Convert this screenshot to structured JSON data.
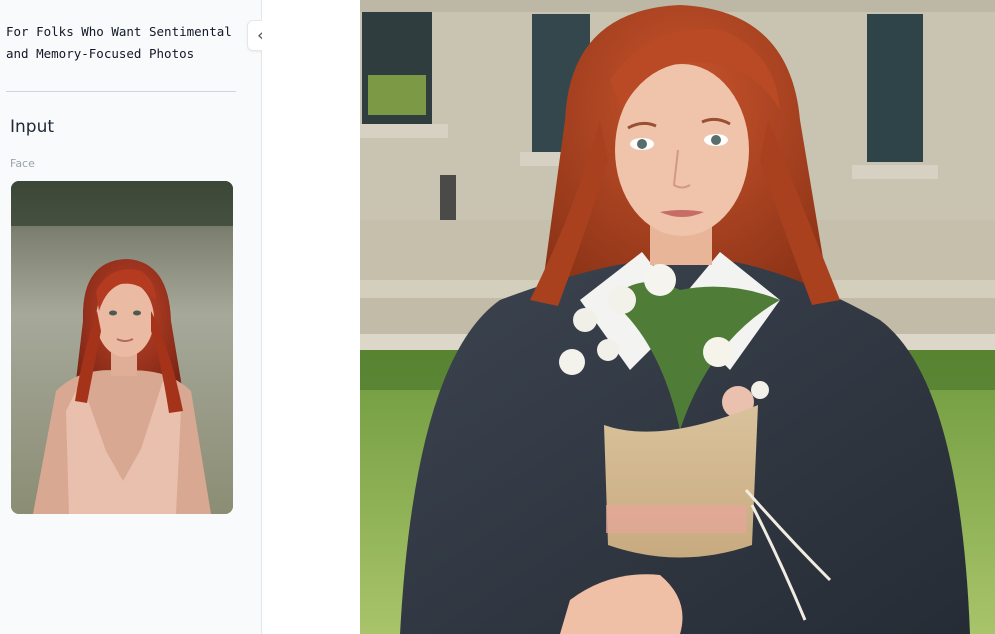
{
  "sidebar": {
    "tagline": "For Folks Who Want Sentimental\nand Memory-Focused Photos",
    "input_section": {
      "title": "Input",
      "face_label": "Face"
    },
    "collapse_button": {
      "icon": "double-chevron-left-icon",
      "glyph": "«"
    }
  },
  "images": {
    "face_input": "redhead-woman-pink-dress-outdoor-photo",
    "result": "redhead-graduate-with-flower-bouquet-photo"
  },
  "colors": {
    "sidebar_bg": "#f9fafb",
    "border": "#e5e7eb",
    "text": "#111827",
    "muted": "#9ca3af"
  }
}
